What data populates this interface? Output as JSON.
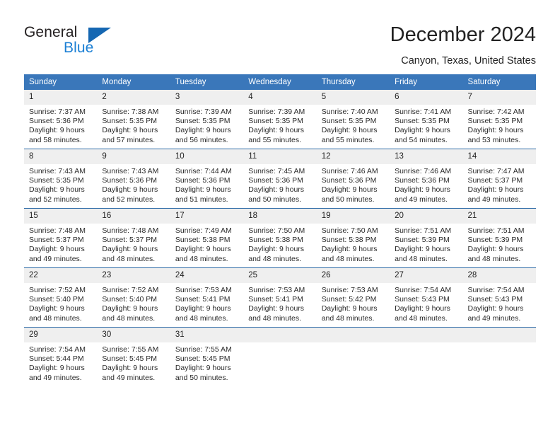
{
  "brand": {
    "name_top": "General",
    "name_bottom": "Blue",
    "triangle_color": "#1567b2",
    "blue_text_color": "#1b7fd4"
  },
  "header": {
    "title": "December 2024",
    "subtitle": "Canyon, Texas, United States"
  },
  "theme": {
    "header_row_bg": "#3a77ba",
    "header_row_text": "#ffffff",
    "row_divider": "#2f6ca8",
    "daynum_bg": "#efefef",
    "page_bg": "#ffffff"
  },
  "calendar": {
    "weekday_headers": [
      "Sunday",
      "Monday",
      "Tuesday",
      "Wednesday",
      "Thursday",
      "Friday",
      "Saturday"
    ],
    "weeks": [
      [
        {
          "day": "1",
          "sunrise": "Sunrise: 7:37 AM",
          "sunset": "Sunset: 5:36 PM",
          "daylight1": "Daylight: 9 hours",
          "daylight2": "and 58 minutes."
        },
        {
          "day": "2",
          "sunrise": "Sunrise: 7:38 AM",
          "sunset": "Sunset: 5:35 PM",
          "daylight1": "Daylight: 9 hours",
          "daylight2": "and 57 minutes."
        },
        {
          "day": "3",
          "sunrise": "Sunrise: 7:39 AM",
          "sunset": "Sunset: 5:35 PM",
          "daylight1": "Daylight: 9 hours",
          "daylight2": "and 56 minutes."
        },
        {
          "day": "4",
          "sunrise": "Sunrise: 7:39 AM",
          "sunset": "Sunset: 5:35 PM",
          "daylight1": "Daylight: 9 hours",
          "daylight2": "and 55 minutes."
        },
        {
          "day": "5",
          "sunrise": "Sunrise: 7:40 AM",
          "sunset": "Sunset: 5:35 PM",
          "daylight1": "Daylight: 9 hours",
          "daylight2": "and 55 minutes."
        },
        {
          "day": "6",
          "sunrise": "Sunrise: 7:41 AM",
          "sunset": "Sunset: 5:35 PM",
          "daylight1": "Daylight: 9 hours",
          "daylight2": "and 54 minutes."
        },
        {
          "day": "7",
          "sunrise": "Sunrise: 7:42 AM",
          "sunset": "Sunset: 5:35 PM",
          "daylight1": "Daylight: 9 hours",
          "daylight2": "and 53 minutes."
        }
      ],
      [
        {
          "day": "8",
          "sunrise": "Sunrise: 7:43 AM",
          "sunset": "Sunset: 5:35 PM",
          "daylight1": "Daylight: 9 hours",
          "daylight2": "and 52 minutes."
        },
        {
          "day": "9",
          "sunrise": "Sunrise: 7:43 AM",
          "sunset": "Sunset: 5:36 PM",
          "daylight1": "Daylight: 9 hours",
          "daylight2": "and 52 minutes."
        },
        {
          "day": "10",
          "sunrise": "Sunrise: 7:44 AM",
          "sunset": "Sunset: 5:36 PM",
          "daylight1": "Daylight: 9 hours",
          "daylight2": "and 51 minutes."
        },
        {
          "day": "11",
          "sunrise": "Sunrise: 7:45 AM",
          "sunset": "Sunset: 5:36 PM",
          "daylight1": "Daylight: 9 hours",
          "daylight2": "and 50 minutes."
        },
        {
          "day": "12",
          "sunrise": "Sunrise: 7:46 AM",
          "sunset": "Sunset: 5:36 PM",
          "daylight1": "Daylight: 9 hours",
          "daylight2": "and 50 minutes."
        },
        {
          "day": "13",
          "sunrise": "Sunrise: 7:46 AM",
          "sunset": "Sunset: 5:36 PM",
          "daylight1": "Daylight: 9 hours",
          "daylight2": "and 49 minutes."
        },
        {
          "day": "14",
          "sunrise": "Sunrise: 7:47 AM",
          "sunset": "Sunset: 5:37 PM",
          "daylight1": "Daylight: 9 hours",
          "daylight2": "and 49 minutes."
        }
      ],
      [
        {
          "day": "15",
          "sunrise": "Sunrise: 7:48 AM",
          "sunset": "Sunset: 5:37 PM",
          "daylight1": "Daylight: 9 hours",
          "daylight2": "and 49 minutes."
        },
        {
          "day": "16",
          "sunrise": "Sunrise: 7:48 AM",
          "sunset": "Sunset: 5:37 PM",
          "daylight1": "Daylight: 9 hours",
          "daylight2": "and 48 minutes."
        },
        {
          "day": "17",
          "sunrise": "Sunrise: 7:49 AM",
          "sunset": "Sunset: 5:38 PM",
          "daylight1": "Daylight: 9 hours",
          "daylight2": "and 48 minutes."
        },
        {
          "day": "18",
          "sunrise": "Sunrise: 7:50 AM",
          "sunset": "Sunset: 5:38 PM",
          "daylight1": "Daylight: 9 hours",
          "daylight2": "and 48 minutes."
        },
        {
          "day": "19",
          "sunrise": "Sunrise: 7:50 AM",
          "sunset": "Sunset: 5:38 PM",
          "daylight1": "Daylight: 9 hours",
          "daylight2": "and 48 minutes."
        },
        {
          "day": "20",
          "sunrise": "Sunrise: 7:51 AM",
          "sunset": "Sunset: 5:39 PM",
          "daylight1": "Daylight: 9 hours",
          "daylight2": "and 48 minutes."
        },
        {
          "day": "21",
          "sunrise": "Sunrise: 7:51 AM",
          "sunset": "Sunset: 5:39 PM",
          "daylight1": "Daylight: 9 hours",
          "daylight2": "and 48 minutes."
        }
      ],
      [
        {
          "day": "22",
          "sunrise": "Sunrise: 7:52 AM",
          "sunset": "Sunset: 5:40 PM",
          "daylight1": "Daylight: 9 hours",
          "daylight2": "and 48 minutes."
        },
        {
          "day": "23",
          "sunrise": "Sunrise: 7:52 AM",
          "sunset": "Sunset: 5:40 PM",
          "daylight1": "Daylight: 9 hours",
          "daylight2": "and 48 minutes."
        },
        {
          "day": "24",
          "sunrise": "Sunrise: 7:53 AM",
          "sunset": "Sunset: 5:41 PM",
          "daylight1": "Daylight: 9 hours",
          "daylight2": "and 48 minutes."
        },
        {
          "day": "25",
          "sunrise": "Sunrise: 7:53 AM",
          "sunset": "Sunset: 5:41 PM",
          "daylight1": "Daylight: 9 hours",
          "daylight2": "and 48 minutes."
        },
        {
          "day": "26",
          "sunrise": "Sunrise: 7:53 AM",
          "sunset": "Sunset: 5:42 PM",
          "daylight1": "Daylight: 9 hours",
          "daylight2": "and 48 minutes."
        },
        {
          "day": "27",
          "sunrise": "Sunrise: 7:54 AM",
          "sunset": "Sunset: 5:43 PM",
          "daylight1": "Daylight: 9 hours",
          "daylight2": "and 48 minutes."
        },
        {
          "day": "28",
          "sunrise": "Sunrise: 7:54 AM",
          "sunset": "Sunset: 5:43 PM",
          "daylight1": "Daylight: 9 hours",
          "daylight2": "and 49 minutes."
        }
      ],
      [
        {
          "day": "29",
          "sunrise": "Sunrise: 7:54 AM",
          "sunset": "Sunset: 5:44 PM",
          "daylight1": "Daylight: 9 hours",
          "daylight2": "and 49 minutes."
        },
        {
          "day": "30",
          "sunrise": "Sunrise: 7:55 AM",
          "sunset": "Sunset: 5:45 PM",
          "daylight1": "Daylight: 9 hours",
          "daylight2": "and 49 minutes."
        },
        {
          "day": "31",
          "sunrise": "Sunrise: 7:55 AM",
          "sunset": "Sunset: 5:45 PM",
          "daylight1": "Daylight: 9 hours",
          "daylight2": "and 50 minutes."
        },
        {
          "day": "",
          "sunrise": "",
          "sunset": "",
          "daylight1": "",
          "daylight2": ""
        },
        {
          "day": "",
          "sunrise": "",
          "sunset": "",
          "daylight1": "",
          "daylight2": ""
        },
        {
          "day": "",
          "sunrise": "",
          "sunset": "",
          "daylight1": "",
          "daylight2": ""
        },
        {
          "day": "",
          "sunrise": "",
          "sunset": "",
          "daylight1": "",
          "daylight2": ""
        }
      ]
    ]
  }
}
